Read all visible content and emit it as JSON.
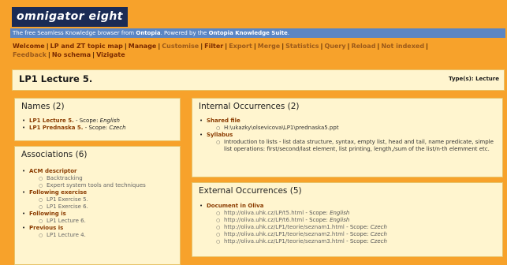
{
  "app": {
    "logo": "omnigator eight",
    "tagline_prefix": "The free Seamless Knowledge browser from",
    "tagline_brand": "Ontopia",
    "tagline_mid": ". Powered by the",
    "tagline_suite": "Ontopia Knowledge Suite",
    "tagline_end": "."
  },
  "menu": {
    "items": [
      {
        "label": "Welcome"
      },
      {
        "label": "LP and ZT topic map"
      },
      {
        "label": "Manage"
      },
      {
        "label": "Customise"
      },
      {
        "label": "Filter"
      },
      {
        "label": "Export"
      },
      {
        "label": "Merge"
      },
      {
        "label": "Statistics"
      },
      {
        "label": "Query"
      },
      {
        "label": "Reload"
      },
      {
        "label": "Not indexed"
      },
      {
        "label": "Feedback"
      },
      {
        "label": "No schema"
      },
      {
        "label": "Vizigate"
      }
    ]
  },
  "page": {
    "title": "LP1 Lecture 5.",
    "types": "Type(s): Lecture"
  },
  "names": {
    "heading": "Names (2)",
    "items": [
      {
        "name": "LP1 Lecture 5.",
        "scope_label": " - Scope:",
        "scope": "English"
      },
      {
        "name": "LP1 Prednaska 5.",
        "scope_label": " - Scope:",
        "scope": "Czech"
      }
    ]
  },
  "associations": {
    "heading": "Associations (6)",
    "groups": [
      {
        "role": "ACM descriptor",
        "items": [
          "Backtracking",
          "Expert system tools and techniques"
        ]
      },
      {
        "role": "Following exercise",
        "items": [
          "LP1 Exercise 5.",
          "LP1 Exercise 6."
        ]
      },
      {
        "role": "Following is",
        "items": [
          "LP1 Lecture 6."
        ]
      },
      {
        "role": "Previous is",
        "items": [
          "LP1 Lecture 4."
        ]
      }
    ]
  },
  "internal": {
    "heading": "Internal Occurrences (2)",
    "groups": [
      {
        "type": "Shared file",
        "items": [
          "H:\\ukazky\\olsevicova\\LP1\\prednaska5.ppt"
        ]
      },
      {
        "type": "Syllabus",
        "items": [
          "Introduction to lists - list data structure, syntax, empty list, head and tail, name predicate, simple list operations: first/second/last element, list printing, length,/sum of the list/n-th elemment etc."
        ]
      }
    ]
  },
  "external": {
    "heading": "External Occurrences (5)",
    "type": "Document in Oliva",
    "items": [
      {
        "url": "http://oliva.uhk.cz/LP/t5.html",
        "scope_label": " - Scope:",
        "scope": "English"
      },
      {
        "url": "http://oliva.uhk.cz/LP/t6.html",
        "scope_label": " - Scope:",
        "scope": "English"
      },
      {
        "url": "http://oliva.uhk.cz/LP1/teorie/seznam1.html",
        "scope_label": " - Scope:",
        "scope": "Czech"
      },
      {
        "url": "http://oliva.uhk.cz/LP1/teorie/seznam2.html",
        "scope_label": " - Scope:",
        "scope": "Czech"
      },
      {
        "url": "http://oliva.uhk.cz/LP1/teorie/seznam3.html",
        "scope_label": " - Scope:",
        "scope": "Czech"
      }
    ]
  }
}
